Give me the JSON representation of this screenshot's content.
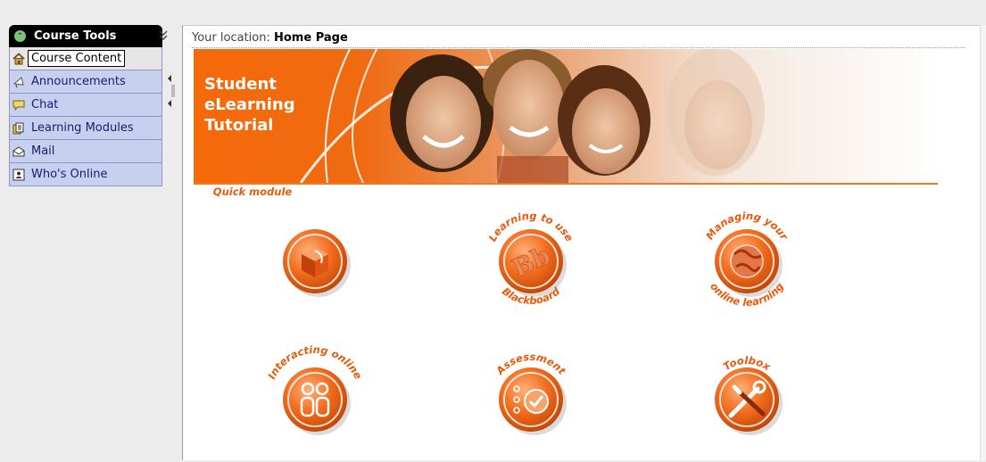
{
  "sidebar": {
    "header": "Course Tools",
    "items": [
      {
        "label": "Course Content",
        "icon": "home-icon"
      },
      {
        "label": "Announcements",
        "icon": "megaphone-icon"
      },
      {
        "label": "Chat",
        "icon": "chat-bubble-icon"
      },
      {
        "label": "Learning Modules",
        "icon": "document-icon"
      },
      {
        "label": "Mail",
        "icon": "envelope-icon"
      },
      {
        "label": "Who's Online",
        "icon": "person-card-icon"
      }
    ]
  },
  "location": {
    "prefix": "Your location:",
    "page": "Home Page"
  },
  "banner": {
    "line1": "Student",
    "line2": "eLearning",
    "line3": "Tutorial"
  },
  "modules": {
    "quick": {
      "top": "Quick module",
      "bottom": ""
    },
    "learning": {
      "top": "Learning to use",
      "bottom": "Blackboard"
    },
    "managing": {
      "top": "Managing your",
      "bottom": "online learning"
    },
    "interacting": {
      "top": "Interacting online",
      "bottom": ""
    },
    "assessment": {
      "top": "Assessment",
      "bottom": ""
    },
    "toolbox": {
      "top": "Toolbox",
      "bottom": ""
    }
  },
  "colors": {
    "accent": "#f26b1d",
    "nav_bg": "#c7d1ef",
    "nav_text": "#1a1a6e"
  }
}
